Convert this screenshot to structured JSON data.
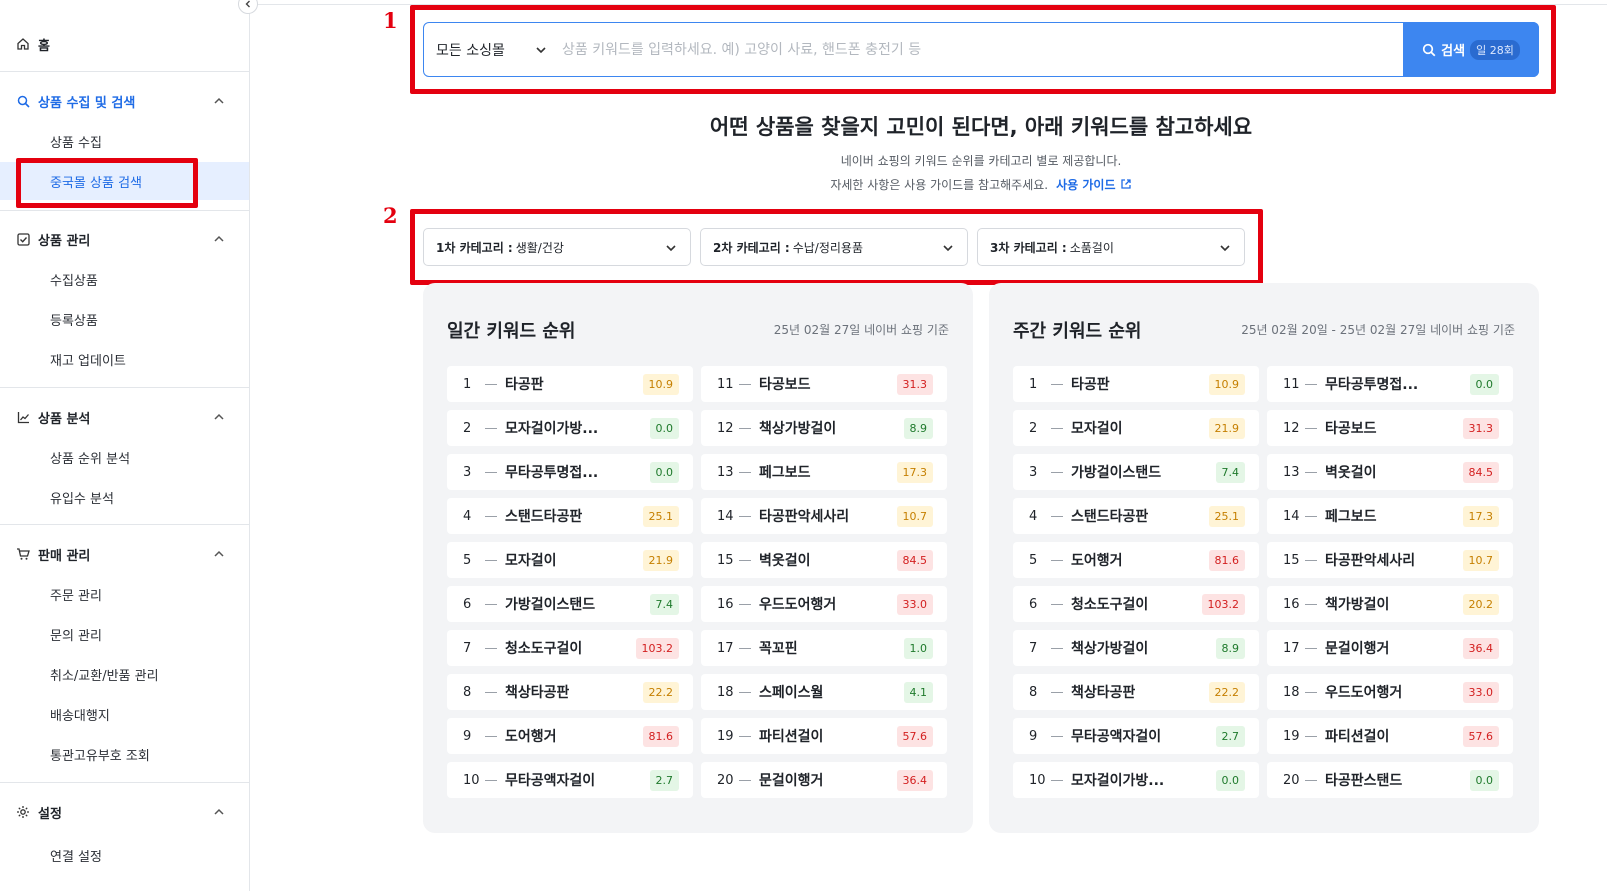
{
  "sidebar": {
    "home": "홈",
    "sections": [
      {
        "label": "상품 수집 및 검색",
        "items": [
          "상품 수집",
          "중국몰 상품 검색"
        ]
      },
      {
        "label": "상품 관리",
        "items": [
          "수집상품",
          "등록상품",
          "재고 업데이트"
        ]
      },
      {
        "label": "상품 분석",
        "items": [
          "상품 순위 분석",
          "유입수 분석"
        ]
      },
      {
        "label": "판매 관리",
        "items": [
          "주문 관리",
          "문의 관리",
          "취소/교환/반품 관리",
          "배송대행지",
          "통관고유부호 조회"
        ]
      },
      {
        "label": "설정",
        "items": [
          "연결 설정"
        ]
      }
    ]
  },
  "annotations": {
    "one": "1",
    "two": "2"
  },
  "search": {
    "mall_select": "모든 소싱몰",
    "placeholder": "상품 키워드를 입력하세요. 예) 고양이 사료, 핸드폰 충전기 등",
    "button_label": "검색",
    "daily_count": "일 28회"
  },
  "heading": {
    "title": "어떤 상품을 찾을지 고민이 된다면, 아래 키워드를 참고하세요",
    "line1": "네이버 쇼핑의 키워드 순위를 카테고리 별로 제공합니다.",
    "line2": "자세한 사항은 사용 가이드를 참고해주세요.",
    "guide_link": "사용 가이드"
  },
  "categories": [
    {
      "prefix": "1차 카테고리 :",
      "value": "생활/건강"
    },
    {
      "prefix": "2차 카테고리 :",
      "value": "수납/정리용품"
    },
    {
      "prefix": "3차 카테고리 :",
      "value": "소품걸이"
    }
  ],
  "daily": {
    "title": "일간 키워드 순위",
    "date": "25년 02월 27일 네이버 쇼핑 기준",
    "rows": [
      {
        "rank": "1",
        "keyword": "타공판",
        "value": "10.9",
        "color": "yellow"
      },
      {
        "rank": "2",
        "keyword": "모자걸이가방...",
        "value": "0.0",
        "color": "green"
      },
      {
        "rank": "3",
        "keyword": "무타공투명접...",
        "value": "0.0",
        "color": "green"
      },
      {
        "rank": "4",
        "keyword": "스탠드타공판",
        "value": "25.1",
        "color": "yellow"
      },
      {
        "rank": "5",
        "keyword": "모자걸이",
        "value": "21.9",
        "color": "yellow"
      },
      {
        "rank": "6",
        "keyword": "가방걸이스탠드",
        "value": "7.4",
        "color": "green"
      },
      {
        "rank": "7",
        "keyword": "청소도구걸이",
        "value": "103.2",
        "color": "red"
      },
      {
        "rank": "8",
        "keyword": "책상타공판",
        "value": "22.2",
        "color": "yellow"
      },
      {
        "rank": "9",
        "keyword": "도어행거",
        "value": "81.6",
        "color": "red"
      },
      {
        "rank": "10",
        "keyword": "무타공액자걸이",
        "value": "2.7",
        "color": "green"
      },
      {
        "rank": "11",
        "keyword": "타공보드",
        "value": "31.3",
        "color": "red"
      },
      {
        "rank": "12",
        "keyword": "책상가방걸이",
        "value": "8.9",
        "color": "green"
      },
      {
        "rank": "13",
        "keyword": "페그보드",
        "value": "17.3",
        "color": "yellow"
      },
      {
        "rank": "14",
        "keyword": "타공판악세사리",
        "value": "10.7",
        "color": "yellow"
      },
      {
        "rank": "15",
        "keyword": "벽옷걸이",
        "value": "84.5",
        "color": "red"
      },
      {
        "rank": "16",
        "keyword": "우드도어행거",
        "value": "33.0",
        "color": "red"
      },
      {
        "rank": "17",
        "keyword": "꼭꼬핀",
        "value": "1.0",
        "color": "green"
      },
      {
        "rank": "18",
        "keyword": "스페이스월",
        "value": "4.1",
        "color": "green"
      },
      {
        "rank": "19",
        "keyword": "파티션걸이",
        "value": "57.6",
        "color": "red"
      },
      {
        "rank": "20",
        "keyword": "문걸이행거",
        "value": "36.4",
        "color": "red"
      }
    ]
  },
  "weekly": {
    "title": "주간 키워드 순위",
    "date": "25년 02월 20일 - 25년 02월 27일 네이버 쇼핑 기준",
    "rows": [
      {
        "rank": "1",
        "keyword": "타공판",
        "value": "10.9",
        "color": "yellow"
      },
      {
        "rank": "2",
        "keyword": "모자걸이",
        "value": "21.9",
        "color": "yellow"
      },
      {
        "rank": "3",
        "keyword": "가방걸이스탠드",
        "value": "7.4",
        "color": "green"
      },
      {
        "rank": "4",
        "keyword": "스탠드타공판",
        "value": "25.1",
        "color": "yellow"
      },
      {
        "rank": "5",
        "keyword": "도어행거",
        "value": "81.6",
        "color": "red"
      },
      {
        "rank": "6",
        "keyword": "청소도구걸이",
        "value": "103.2",
        "color": "red"
      },
      {
        "rank": "7",
        "keyword": "책상가방걸이",
        "value": "8.9",
        "color": "green"
      },
      {
        "rank": "8",
        "keyword": "책상타공판",
        "value": "22.2",
        "color": "yellow"
      },
      {
        "rank": "9",
        "keyword": "무타공액자걸이",
        "value": "2.7",
        "color": "green"
      },
      {
        "rank": "10",
        "keyword": "모자걸이가방...",
        "value": "0.0",
        "color": "green"
      },
      {
        "rank": "11",
        "keyword": "무타공투명접...",
        "value": "0.0",
        "color": "green"
      },
      {
        "rank": "12",
        "keyword": "타공보드",
        "value": "31.3",
        "color": "red"
      },
      {
        "rank": "13",
        "keyword": "벽옷걸이",
        "value": "84.5",
        "color": "red"
      },
      {
        "rank": "14",
        "keyword": "페그보드",
        "value": "17.3",
        "color": "yellow"
      },
      {
        "rank": "15",
        "keyword": "타공판악세사리",
        "value": "10.7",
        "color": "yellow"
      },
      {
        "rank": "16",
        "keyword": "책가방걸이",
        "value": "20.2",
        "color": "yellow"
      },
      {
        "rank": "17",
        "keyword": "문걸이행거",
        "value": "36.4",
        "color": "red"
      },
      {
        "rank": "18",
        "keyword": "우드도어행거",
        "value": "33.0",
        "color": "red"
      },
      {
        "rank": "19",
        "keyword": "파티션걸이",
        "value": "57.6",
        "color": "red"
      },
      {
        "rank": "20",
        "keyword": "타공판스탠드",
        "value": "0.0",
        "color": "green"
      }
    ]
  },
  "colors": {
    "accent": "#3d86f0",
    "annotation": "#e4000f",
    "selected_bg": "#e6efff"
  }
}
